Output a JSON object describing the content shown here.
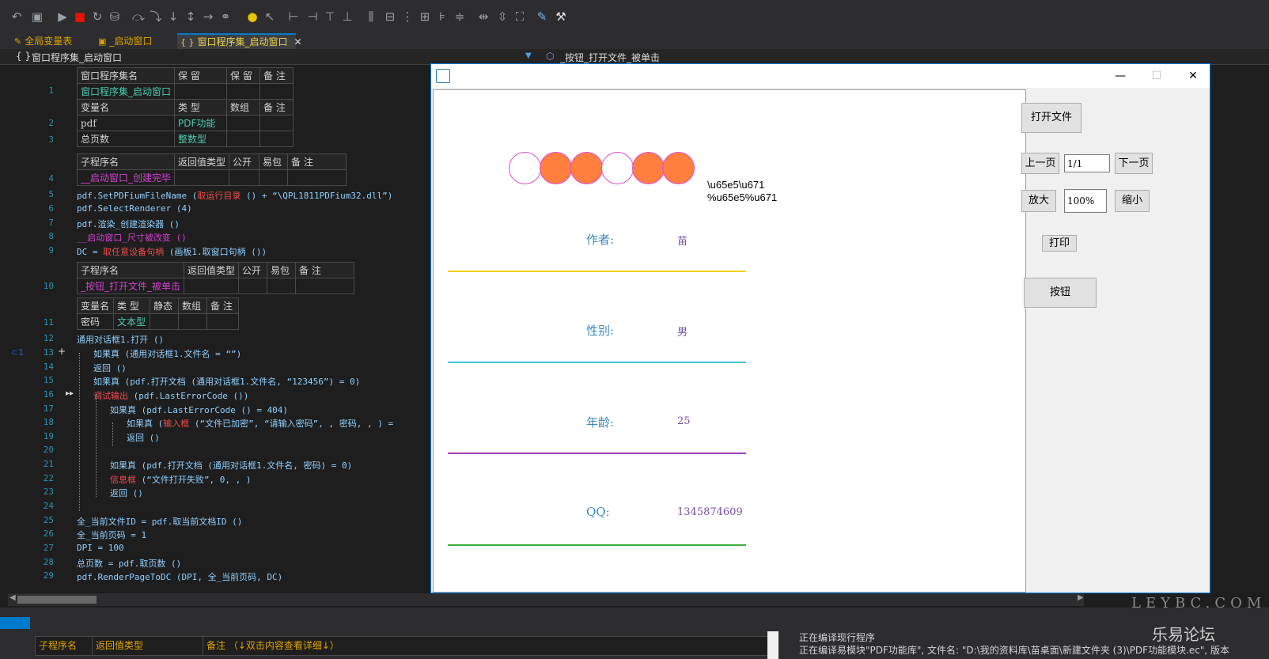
{
  "tabs": [
    {
      "label": "全局变量表",
      "active": false
    },
    {
      "label": "_启动窗口",
      "active": false
    },
    {
      "label": "窗口程序集_启动窗口",
      "active": true
    }
  ],
  "navbar": {
    "left": "窗口程序集_启动窗口",
    "right": "_按钮_打开文件_被单击"
  },
  "decl1": {
    "headers": [
      "窗口程序集名",
      "保 留",
      "保 留",
      "备 注"
    ],
    "row": [
      "窗口程序集_启动窗口",
      "",
      "",
      ""
    ],
    "var_headers": [
      "变量名",
      "类 型",
      "数组",
      "备 注"
    ],
    "vars": [
      [
        "pdf",
        "PDF功能",
        "",
        ""
      ],
      [
        "总页数",
        "整数型",
        "",
        ""
      ]
    ]
  },
  "sub1": {
    "headers": [
      "子程序名",
      "返回值类型",
      "公开",
      "易包",
      "备 注"
    ],
    "name": "__启动窗口_创建完毕"
  },
  "sub2": {
    "headers": [
      "子程序名",
      "返回值类型",
      "公开",
      "易包",
      "备 注"
    ],
    "name": "_按钮_打开文件_被单击"
  },
  "sub2vars": {
    "headers": [
      "变量名",
      "类 型",
      "静态",
      "数组",
      "备 注"
    ],
    "row": [
      "密码",
      "文本型",
      "",
      "",
      ""
    ]
  },
  "line_numbers": [
    "1",
    "2",
    "3",
    "4",
    "5",
    "6",
    "7",
    "8",
    "9",
    "10",
    "11",
    "12",
    "13",
    "14",
    "15",
    "16",
    "17",
    "18",
    "19",
    "20",
    "21",
    "22",
    "23",
    "24",
    "25",
    "26",
    "27",
    "28",
    "29"
  ],
  "code": {
    "l5a": "pdf.SetPDFiumFileName (",
    "l5b": "取运行目录",
    "l5c": " () + “\\QPL1811PDFium32.dll”)",
    "l6": "pdf.SelectRenderer (4)",
    "l7": "pdf.渲染_创建渲染器 ()",
    "l8": "__启动窗口_尺寸被改变 ()",
    "l9a": "DC = ",
    "l9b": "取任意设备句柄",
    "l9c": " (画板1.取窗口句柄 ())",
    "l12": "通用对话框1.打开 ()",
    "l13": "如果真 (通用对话框1.文件名 = “”)",
    "l14": "返回 ()",
    "l15": "如果真 (pdf.打开文档 (通用对话框1.文件名, “123456”) = 0)",
    "l16a": "调试输出",
    "l16b": " (pdf.LastErrorCode ())",
    "l17": "如果真 (pdf.LastErrorCode () = 404)",
    "l18a": "如果真 (",
    "l18b": "输入框",
    "l18c": " (“文件已加密”, “请输入密码”, , 密码, , ) =",
    "l19": "返回 ()",
    "l21": "如果真 (pdf.打开文档 (通用对话框1.文件名, 密码) = 0)",
    "l22a": "信息框",
    "l22b": " (“文件打开失败”, 0, , )",
    "l23": "返回 ()",
    "l25": "全_当前文件ID = pdf.取当前文档ID ()",
    "l26": "全_当前页码 = 1",
    "l27": "DPI = 100",
    "l28": "总页数 = pdf.取页数 ()",
    "l29": "pdf.RenderPageToDC (DPI, 全_当前页码, DC)"
  },
  "bottom_table": {
    "col1": "子程序名",
    "col2": "返回值类型",
    "col3": "备注 （↓双击内容查看详细↓）"
  },
  "status_log": [
    "正在编译现行程序",
    "正在编译易模块\"PDF功能库\", 文件名: \"D:\\我的资料库\\苗桌面\\新建文件夹 (3)\\PDF功能模块.ec\", 版本"
  ],
  "watermark": {
    "site": "LEYBC.COM",
    "brand": "乐易论坛"
  },
  "app": {
    "window_controls": {
      "minimize": "—",
      "maximize": "☐",
      "close": "✕"
    },
    "doc_text": {
      "escaped1": "\\u65e5\\u671",
      "escaped2": "%u65e5%u671"
    },
    "fields": [
      {
        "label": "作者:",
        "value": "苗",
        "line_color": "#f0d000"
      },
      {
        "label": "性别:",
        "value": "男",
        "line_color": "#40c8d8"
      },
      {
        "label": "年龄:",
        "value": "25",
        "line_color": "#a040c0"
      },
      {
        "label": "QQ:",
        "value": "1345874609",
        "line_color": "#40b040"
      }
    ],
    "circles": [
      "empty",
      "full",
      "full",
      "empty",
      "full",
      "full"
    ],
    "buttons": {
      "open": "打开文件",
      "prev": "上一页",
      "next": "下一页",
      "zoom_in": "放大",
      "zoom_out": "缩小",
      "print": "打印",
      "button": "按钮"
    },
    "inputs": {
      "page": "1/1",
      "zoom": "100%"
    }
  }
}
